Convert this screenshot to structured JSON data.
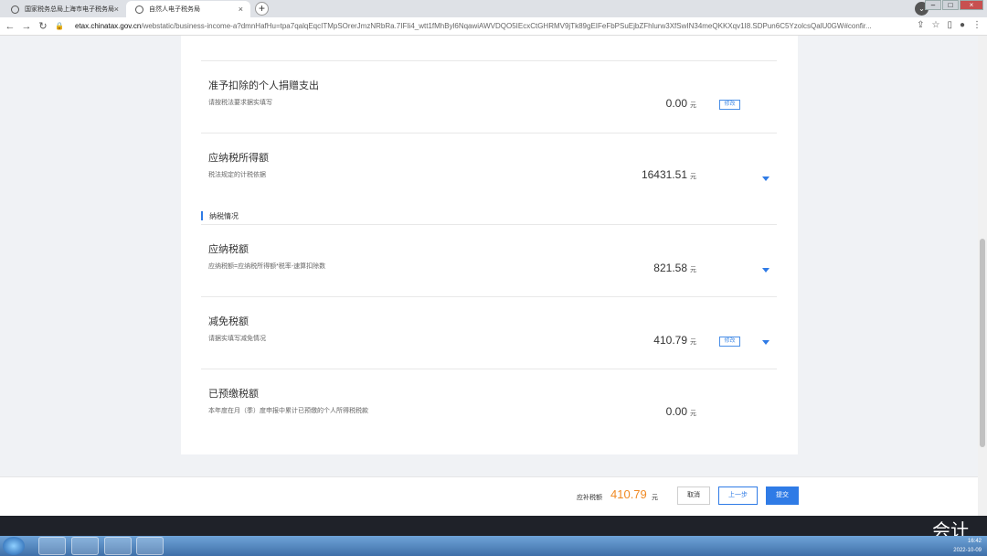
{
  "browser": {
    "tabs": [
      {
        "label": "国家税务总局上海市电子税务局"
      },
      {
        "label": "自然人电子税务局"
      }
    ],
    "url_host": "etax.chinatax.gov.cn",
    "url_path": "/webstatic/business-income-a?dmnHafHu=tpa7qalqEqcITMpSOrerJmzNRbRa.7IFIi4_wtt1fMhByl6NqawiAWVDQO5IEcxCtGHRMV9jTk89gEIFeFbPSuEjbZFhlurw3XfSwIN34meQKKXqv1I8.SDPun6C5YzolcsQalU0GW#confir..."
  },
  "rows": [
    {
      "title": "准予扣除的个人捐赠支出",
      "desc": "请按税法要求据实填写",
      "amount": "0.00",
      "unit": "元",
      "edit": "修改"
    },
    {
      "title": "应纳税所得额",
      "desc": "税法规定的计税依据",
      "amount": "16431.51",
      "unit": "元"
    },
    {
      "title": "应纳税额",
      "desc": "应纳税额=应纳税所得额*税率-速算扣除数",
      "amount": "821.58",
      "unit": "元"
    },
    {
      "title": "减免税额",
      "desc": "请据实填写减免情况",
      "amount": "410.79",
      "unit": "元",
      "edit": "修改"
    },
    {
      "title": "已预缴税额",
      "desc": "本年度在月（季）度申报中累计已预缴的个人所得税税款",
      "amount": "0.00",
      "unit": "元"
    }
  ],
  "section_label": "纳税情况",
  "footer": {
    "due_label": "应补税额",
    "due_amount": "410.79",
    "due_unit": "元",
    "cancel": "取消",
    "prev": "上一步",
    "submit": "提交"
  },
  "watermark": "会计",
  "taskbar": {
    "time": "16:42",
    "date": "2022-10-09"
  }
}
